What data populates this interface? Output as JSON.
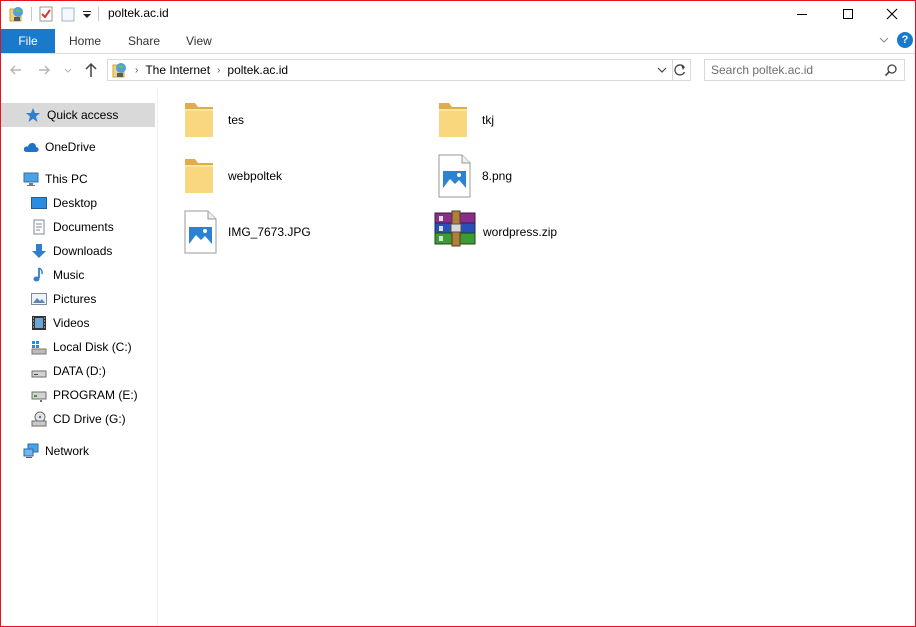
{
  "window": {
    "title": "poltek.ac.id",
    "border_color": "#e81123",
    "minimize_label": "—",
    "maximize_label": "☐",
    "close_label": "✕"
  },
  "ribbon": {
    "file_label": "File",
    "tabs": [
      {
        "label": "Home"
      },
      {
        "label": "Share"
      },
      {
        "label": "View"
      }
    ],
    "help_label": "?",
    "accent_color": "#1979ca"
  },
  "address_bar": {
    "crumbs": [
      "The Internet",
      "poltek.ac.id"
    ],
    "search_placeholder": "Search poltek.ac.id"
  },
  "navigation": {
    "items": [
      {
        "label": "Quick access",
        "icon": "star-icon",
        "selected": true
      },
      {
        "label": "OneDrive",
        "icon": "cloud-icon"
      },
      {
        "label": "This PC",
        "icon": "computer-icon"
      },
      {
        "label": "Desktop",
        "icon": "desktop-icon"
      },
      {
        "label": "Documents",
        "icon": "documents-icon"
      },
      {
        "label": "Downloads",
        "icon": "download-arrow-icon"
      },
      {
        "label": "Music",
        "icon": "music-note-icon"
      },
      {
        "label": "Pictures",
        "icon": "pictures-icon"
      },
      {
        "label": "Videos",
        "icon": "film-strip-icon"
      },
      {
        "label": "Local Disk (C:)",
        "icon": "windows-drive-icon"
      },
      {
        "label": "DATA (D:)",
        "icon": "drive-icon"
      },
      {
        "label": "PROGRAM (E:)",
        "icon": "network-drive-icon"
      },
      {
        "label": "CD Drive (G:)",
        "icon": "cd-drive-icon"
      },
      {
        "label": "Network",
        "icon": "network-icon"
      }
    ]
  },
  "files": [
    {
      "name": "tes",
      "type": "folder",
      "icon": "folder-icon"
    },
    {
      "name": "tkj",
      "type": "folder",
      "icon": "folder-icon"
    },
    {
      "name": "webpoltek",
      "type": "folder",
      "icon": "folder-icon"
    },
    {
      "name": "8.png",
      "type": "image",
      "icon": "image-file-icon"
    },
    {
      "name": "IMG_7673.JPG",
      "type": "image",
      "icon": "image-file-icon"
    },
    {
      "name": "wordpress.zip",
      "type": "archive",
      "icon": "winrar-archive-icon"
    }
  ]
}
